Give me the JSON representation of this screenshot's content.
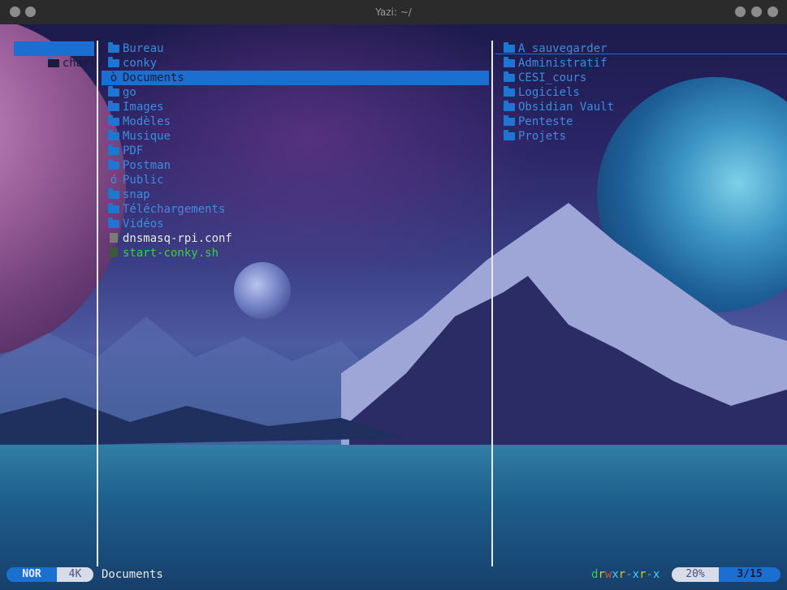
{
  "window": {
    "title": "Yazi: ~/"
  },
  "parent": {
    "items": [
      {
        "name": "charly",
        "selected": true
      }
    ]
  },
  "current": {
    "items": [
      {
        "name": "Bureau",
        "icon": "folder-icon",
        "type": "dir"
      },
      {
        "name": "conky",
        "icon": "folder-icon",
        "type": "dir"
      },
      {
        "name": "Documents",
        "icon": "documents-folder-icon",
        "glyph": "ò",
        "type": "dir",
        "selected": true
      },
      {
        "name": "go",
        "icon": "folder-icon",
        "type": "dir"
      },
      {
        "name": "Images",
        "icon": "folder-icon",
        "type": "dir"
      },
      {
        "name": "Modèles",
        "icon": "folder-icon",
        "type": "dir"
      },
      {
        "name": "Musique",
        "icon": "folder-icon",
        "type": "dir"
      },
      {
        "name": "PDF",
        "icon": "folder-icon",
        "type": "dir"
      },
      {
        "name": "Postman",
        "icon": "folder-icon",
        "type": "dir"
      },
      {
        "name": "Public",
        "icon": "public-folder-icon",
        "glyph": "ó",
        "type": "dir"
      },
      {
        "name": "snap",
        "icon": "folder-icon",
        "type": "dir"
      },
      {
        "name": "Téléchargements",
        "icon": "folder-icon",
        "type": "dir"
      },
      {
        "name": "Vidéos",
        "icon": "folder-icon",
        "type": "dir"
      },
      {
        "name": "dnsmasq-rpi.conf",
        "icon": "config-file-icon",
        "type": "config"
      },
      {
        "name": "start-conky.sh",
        "icon": "shell-script-icon",
        "type": "script"
      }
    ]
  },
  "preview": {
    "items": [
      {
        "name": "A sauvegarder"
      },
      {
        "name": "Administratif"
      },
      {
        "name": "CESI_cours"
      },
      {
        "name": "Logiciels"
      },
      {
        "name": "Obsidian Vault"
      },
      {
        "name": "Penteste"
      },
      {
        "name": "Projets"
      }
    ]
  },
  "status": {
    "mode": "NOR",
    "size": "4K",
    "current_name": "Documents",
    "permissions": [
      "d",
      "r",
      "w",
      "x",
      "r",
      "-",
      "x",
      "r",
      "-",
      "x"
    ],
    "perm_colors": {
      "d": "#3cc84f",
      "r": "#e0c030",
      "w": "#e0503a",
      "x": "#40d0ff",
      "-": "#8090b0"
    },
    "percent": "20%",
    "position": "3/15"
  },
  "colors": {
    "accent": "#1a6fd1",
    "dir": "#3c8dde",
    "config_file": "#e8e8e8",
    "script": "#3cd03c"
  }
}
